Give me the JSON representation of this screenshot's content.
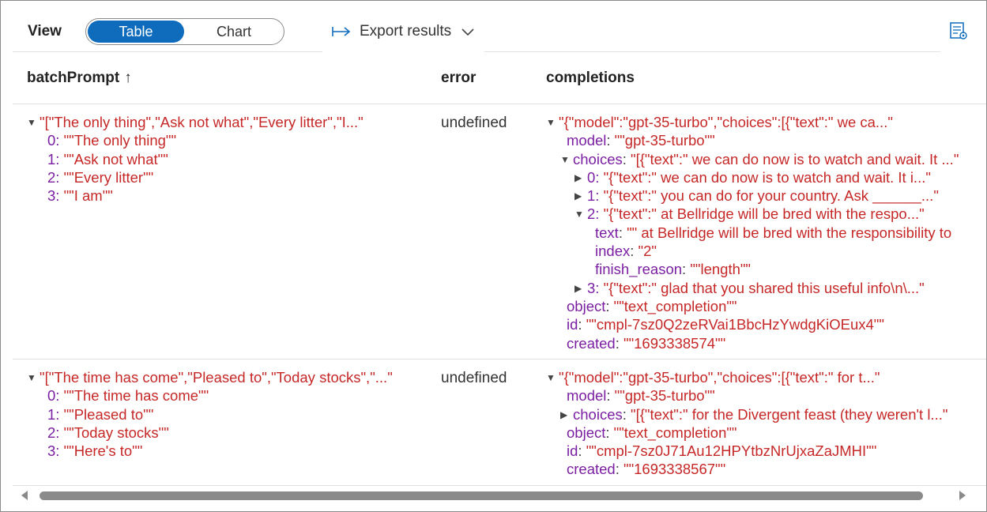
{
  "toolbar": {
    "view_label": "View",
    "toggle": {
      "options": [
        "Table",
        "Chart"
      ],
      "selected": "Table"
    },
    "export_label": "Export results",
    "colors": {
      "accent": "#0f6cbd"
    },
    "icons": {
      "export": "arrow-right-icon",
      "dropdown": "chevron-down-icon",
      "settings": "table-settings-icon"
    }
  },
  "table": {
    "headers": {
      "batchPrompt": "batchPrompt",
      "error": "error",
      "completions": "completions"
    },
    "sort_indicator": "↑",
    "rows": [
      {
        "batchPrompt": {
          "summary": "\"[\"The only thing\",\"Ask not what\",\"Every litter\",\"I...\"",
          "items": [
            {
              "k": "0:",
              "v": "\"\"The only thing\"\""
            },
            {
              "k": "1:",
              "v": "\"\"Ask not what\"\""
            },
            {
              "k": "2:",
              "v": "\"\"Every litter\"\""
            },
            {
              "k": "3:",
              "v": "\"\"I am\"\""
            }
          ]
        },
        "error": "undefined",
        "completions": {
          "summary": "\"{\"model\":\"gpt-35-turbo\",\"choices\":[{\"text\":\" we ca...\"",
          "model": {
            "k": "model",
            "v": "\"\"gpt-35-turbo\"\""
          },
          "choices": {
            "k": "choices",
            "summary": "\"[{\"text\":\" we can do now is to watch and wait. It ...\"",
            "items": [
              {
                "k": "0:",
                "v": "\"{\"text\":\" we can do now is to watch and wait. It i...\""
              },
              {
                "k": "1:",
                "v": "\"{\"text\":\" you can do for your country. Ask ______...\""
              },
              {
                "k": "2:",
                "v": "\"{\"text\":\" at Bellridge will be bred with the respo...\""
              },
              {
                "k": "3:",
                "v": "\"{\"text\":\" glad that you shared this useful info\\n\\...\""
              }
            ],
            "expanded": {
              "text": {
                "k": "text",
                "v": "\"\" at Bellridge will be bred with the responsibility to"
              },
              "index": {
                "k": "index",
                "v": "\"2\""
              },
              "finish_reason": {
                "k": "finish_reason",
                "v": "\"\"length\"\""
              }
            }
          },
          "object": {
            "k": "object",
            "v": "\"\"text_completion\"\""
          },
          "id": {
            "k": "id",
            "v": "\"\"cmpl-7sz0Q2zeRVai1BbcHzYwdgKiOEux4\"\""
          },
          "created": {
            "k": "created",
            "v": "\"\"1693338574\"\""
          }
        }
      },
      {
        "batchPrompt": {
          "summary": "\"[\"The time has come\",\"Pleased to\",\"Today stocks\",\"...\"",
          "items": [
            {
              "k": "0:",
              "v": "\"\"The time has come\"\""
            },
            {
              "k": "1:",
              "v": "\"\"Pleased to\"\""
            },
            {
              "k": "2:",
              "v": "\"\"Today stocks\"\""
            },
            {
              "k": "3:",
              "v": "\"\"Here's to\"\""
            }
          ]
        },
        "error": "undefined",
        "completions": {
          "summary": "\"{\"model\":\"gpt-35-turbo\",\"choices\":[{\"text\":\" for t...\"",
          "model": {
            "k": "model",
            "v": "\"\"gpt-35-turbo\"\""
          },
          "choices": {
            "k": "choices",
            "summary": "\"[{\"text\":\" for the Divergent feast (they weren't l...\""
          },
          "object": {
            "k": "object",
            "v": "\"\"text_completion\"\""
          },
          "id": {
            "k": "id",
            "v": "\"\"cmpl-7sz0J71Au12HPYtbzNrUjxaZaJMHI\"\""
          },
          "created": {
            "k": "created",
            "v": "\"\"1693338567\"\""
          }
        }
      }
    ]
  }
}
